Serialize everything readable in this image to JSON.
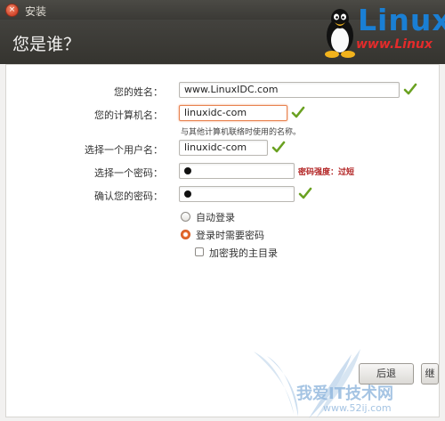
{
  "window": {
    "title": "安装"
  },
  "header": {
    "page_title": "您是谁？"
  },
  "logo": {
    "text": "Linux",
    "url": "www.Linux"
  },
  "form": {
    "name_label": "您的姓名：",
    "name_value": "www.LinuxIDC.com",
    "computer_label": "您的计算机名：",
    "computer_value": "linuxidc-com",
    "computer_hint": "与其他计算机联络时使用的名称。",
    "username_label": "选择一个用户名：",
    "username_value": "linuxidc-com",
    "password_label": "选择一个密码：",
    "password_strength": "密码强度：过短",
    "confirm_label": "确认您的密码："
  },
  "options": {
    "auto_login": "自动登录",
    "require_password": "登录时需要密码",
    "encrypt_home": "加密我的主目录",
    "selected": "require_password"
  },
  "buttons": {
    "back": "后退",
    "forward": "继"
  },
  "watermark": {
    "text": "我爱IT技术网",
    "url": "www.52ij.com"
  },
  "colors": {
    "check": "#6aa121",
    "focus": "#e8824f",
    "strength": "#b22222",
    "header": "#3c3b37"
  }
}
